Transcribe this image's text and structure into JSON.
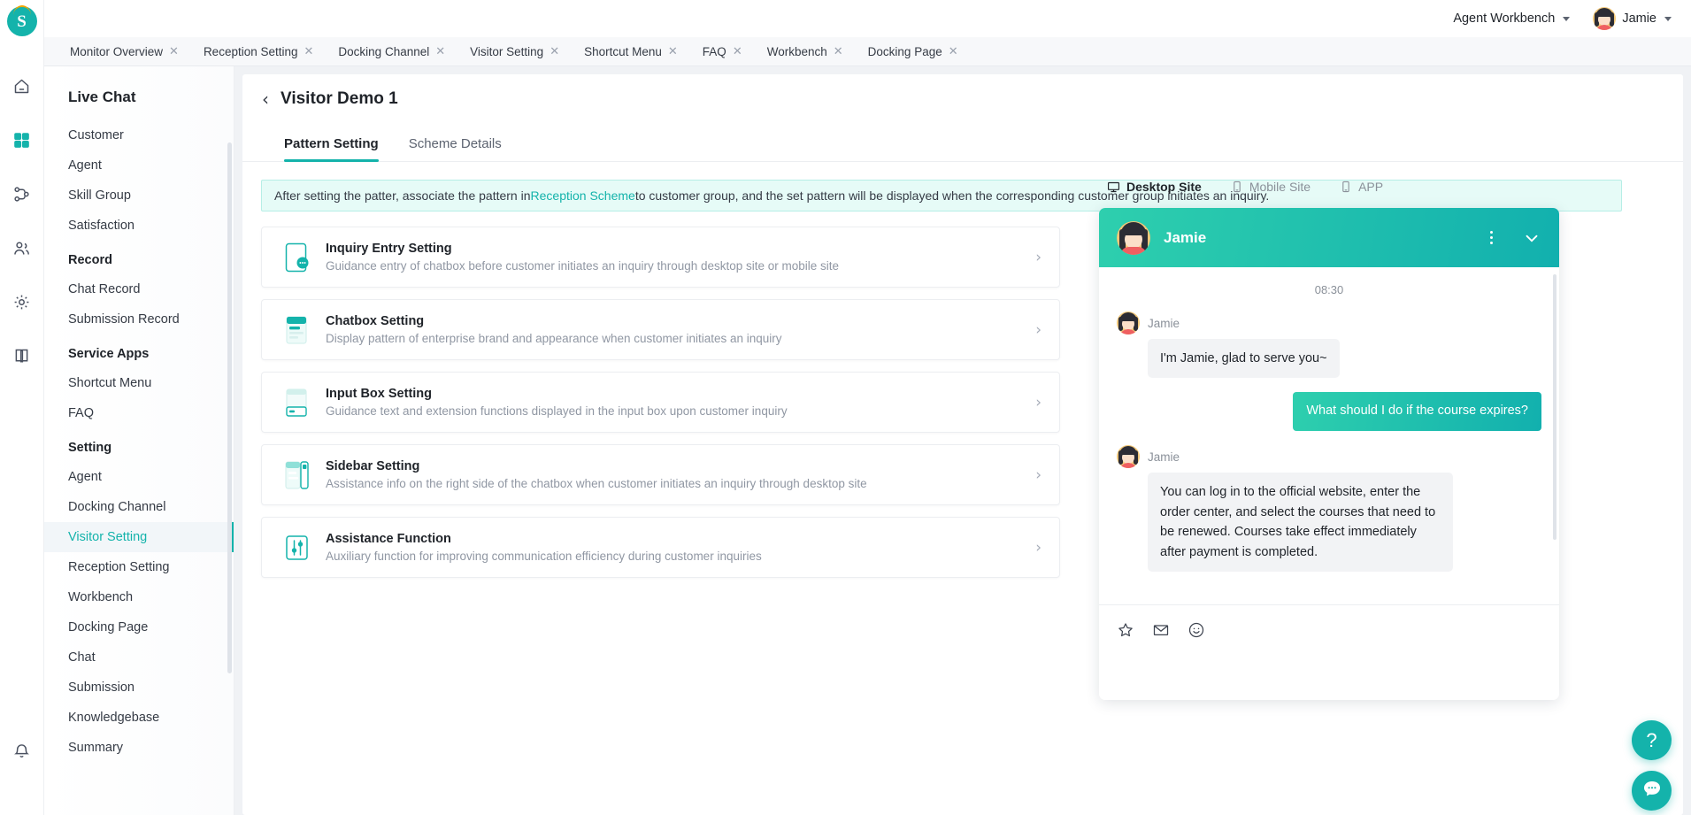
{
  "topbar": {
    "workspace_label": "Agent Workbench",
    "user_name": "Jamie"
  },
  "rail": {
    "logo_letter": "S",
    "icons": [
      "home-icon",
      "apps-grid-icon",
      "flow-icon",
      "contacts-icon",
      "gear-icon",
      "book-icon",
      "bell-icon"
    ]
  },
  "tabs": [
    {
      "label": "Monitor Overview"
    },
    {
      "label": "Reception Setting"
    },
    {
      "label": "Docking Channel"
    },
    {
      "label": "Visitor Setting"
    },
    {
      "label": "Shortcut Menu"
    },
    {
      "label": "FAQ"
    },
    {
      "label": "Workbench"
    },
    {
      "label": "Docking Page"
    }
  ],
  "sidebar": {
    "title": "Live Chat",
    "groups": [
      {
        "label": "",
        "items": [
          {
            "label": "Customer",
            "active": false
          },
          {
            "label": "Agent",
            "active": false
          },
          {
            "label": "Skill Group",
            "active": false
          },
          {
            "label": "Satisfaction",
            "active": false
          }
        ]
      },
      {
        "label": "Record",
        "items": [
          {
            "label": "Chat Record",
            "active": false
          },
          {
            "label": "Submission Record",
            "active": false
          }
        ]
      },
      {
        "label": "Service Apps",
        "items": [
          {
            "label": "Shortcut Menu",
            "active": false
          },
          {
            "label": "FAQ",
            "active": false
          }
        ]
      },
      {
        "label": "Setting",
        "items": [
          {
            "label": "Agent",
            "active": false
          },
          {
            "label": "Docking Channel",
            "active": false
          },
          {
            "label": "Visitor Setting",
            "active": true
          },
          {
            "label": "Reception Setting",
            "active": false
          },
          {
            "label": "Workbench",
            "active": false
          },
          {
            "label": "Docking Page",
            "active": false
          },
          {
            "label": "Chat",
            "active": false
          },
          {
            "label": "Submission",
            "active": false
          },
          {
            "label": "Knowledgebase",
            "active": false
          },
          {
            "label": "Summary",
            "active": false
          }
        ]
      }
    ]
  },
  "page": {
    "title": "Visitor Demo 1",
    "back_icon": "chevron-left-icon",
    "tabs": [
      {
        "label": "Pattern Setting",
        "active": true
      },
      {
        "label": "Scheme Details",
        "active": false
      }
    ],
    "banner": {
      "text_before": "After setting the patter, associate the pattern in",
      "link_text": "Reception Scheme",
      "text_after": "to customer group, and the set pattern will be displayed when the corresponding customer group initiates an inquiry."
    },
    "cards": [
      {
        "title": "Inquiry Entry Setting",
        "desc": "Guidance entry of chatbox before customer initiates an inquiry through desktop site or mobile site",
        "icon": "inquiry-entry-icon"
      },
      {
        "title": "Chatbox Setting",
        "desc": "Display pattern of enterprise brand and appearance when customer initiates an inquiry",
        "icon": "chatbox-icon"
      },
      {
        "title": "Input Box Setting",
        "desc": "Guidance text and extension functions displayed in the input box upon customer inquiry",
        "icon": "input-box-icon"
      },
      {
        "title": "Sidebar Setting",
        "desc": "Assistance info on the right side of the chatbox when customer initiates an inquiry through desktop site",
        "icon": "sidebar-layout-icon"
      },
      {
        "title": "Assistance Function",
        "desc": "Auxiliary function for improving communication efficiency during customer inquiries",
        "icon": "sliders-icon"
      }
    ]
  },
  "preview": {
    "tabs": [
      {
        "label": "Desktop Site",
        "icon": "desktop-icon",
        "active": true
      },
      {
        "label": "Mobile Site",
        "icon": "mobile-icon",
        "active": false
      },
      {
        "label": "APP",
        "icon": "app-icon",
        "active": false
      }
    ],
    "chat": {
      "agent_name": "Jamie",
      "timestamp": "08:30",
      "messages": [
        {
          "from": "agent",
          "sender": "Jamie",
          "text": "I'm Jamie, glad to serve you~"
        },
        {
          "from": "visitor",
          "sender": "",
          "text": "What should I do if the course expires?"
        },
        {
          "from": "agent",
          "sender": "Jamie",
          "text": "You can log in to the official website, enter the order center, and select the courses that need to be renewed. Courses take effect immediately after payment is completed."
        }
      ],
      "input_tools": [
        "star-icon",
        "envelope-icon",
        "emoji-icon"
      ]
    }
  },
  "floating": {
    "help_label": "?",
    "help_icon": "question-mark-icon",
    "chat_icon": "chat-bubble-icon"
  },
  "colors": {
    "accent": "#14b3ab",
    "accent_light": "#2ecfae",
    "banner_bg": "#e6fbf7",
    "sidebar_active_bg": "#f2f6f9"
  }
}
